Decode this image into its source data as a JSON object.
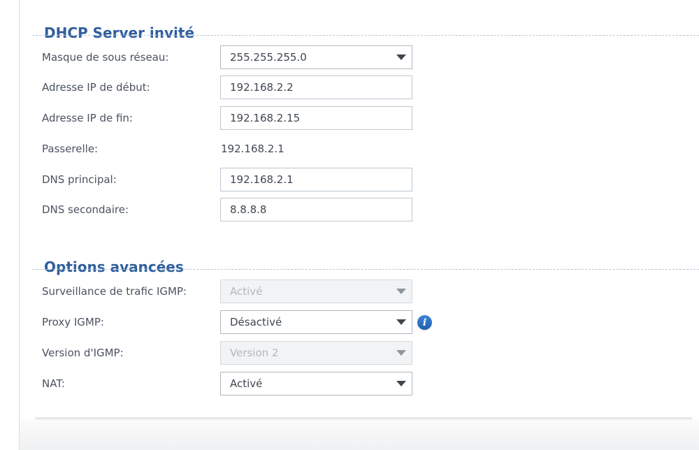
{
  "sections": [
    {
      "title": "DHCP Server invité",
      "fields": [
        {
          "label": "Masque de sous réseau:",
          "value": "255.255.255.0",
          "control": "select"
        },
        {
          "label": "Adresse IP de début:",
          "value": "192.168.2.2",
          "control": "input"
        },
        {
          "label": "Adresse IP de fin:",
          "value": "192.168.2.15",
          "control": "input"
        },
        {
          "label": "Passerelle:",
          "value": "192.168.2.1",
          "control": "static"
        },
        {
          "label": "DNS principal:",
          "value": "192.168.2.1",
          "control": "input"
        },
        {
          "label": "DNS secondaire:",
          "value": "8.8.8.8",
          "control": "input"
        }
      ]
    },
    {
      "title": "Options avancées",
      "fields": [
        {
          "label": "Surveillance de trafic IGMP:",
          "value": "Activé",
          "control": "select",
          "disabled": true
        },
        {
          "label": "Proxy IGMP:",
          "value": "Désactivé",
          "control": "select",
          "disabled": false
        },
        {
          "label": "Version d'IGMP:",
          "value": "Version 2",
          "control": "select",
          "disabled": true
        },
        {
          "label": "NAT:",
          "value": "Activé",
          "control": "select",
          "disabled": false
        }
      ]
    }
  ],
  "icons": {
    "info": "i",
    "chevron_down": "▼"
  },
  "colors": {
    "heading_blue": "#2f5e9c",
    "label_gray": "#4a5260",
    "value_gray": "#3f4651",
    "disabled_bg": "#f2f3f5",
    "disabled_text": "#b2b7bf",
    "dashed_divider": "#b7c5d6",
    "info_icon_blue": "#2a6fc2"
  }
}
